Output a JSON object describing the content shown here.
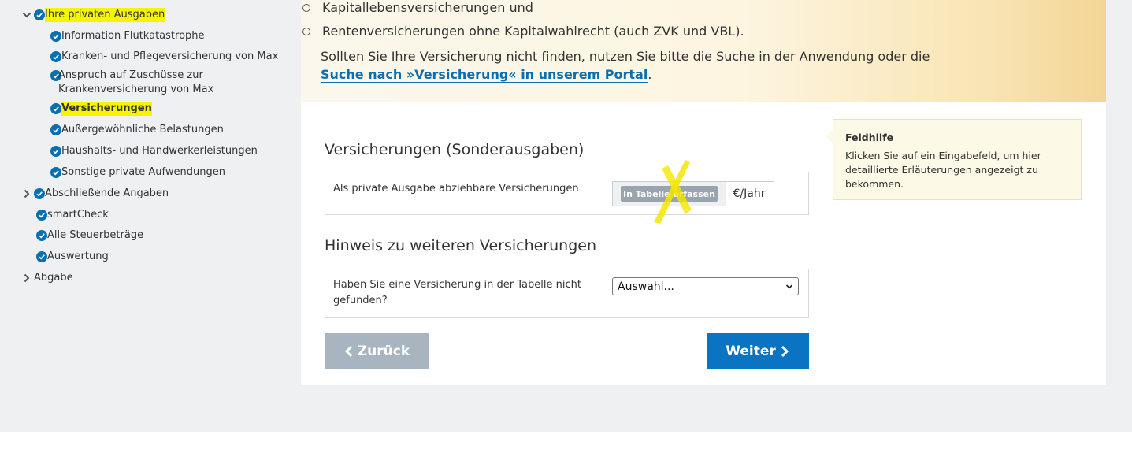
{
  "sidebar": {
    "items": [
      {
        "label": "Ihre privaten Ausgaben"
      },
      {
        "label": "Information Flutkatastrophe"
      },
      {
        "label": "Kranken- und Pflegeversicherung von Max"
      },
      {
        "label": "Anspruch auf Zuschüsse zur Krankenversicherung von Max"
      },
      {
        "label": "Versicherungen"
      },
      {
        "label": "Außergewöhnliche Belastungen"
      },
      {
        "label": "Haushalts- und Handwerkerleistungen"
      },
      {
        "label": "Sonstige private Aufwendungen"
      },
      {
        "label": "Abschließende Angaben"
      },
      {
        "label": "smartCheck"
      },
      {
        "label": "Alle Steuerbeträge"
      },
      {
        "label": "Auswertung"
      },
      {
        "label": "Abgabe"
      }
    ]
  },
  "hero": {
    "bullets": [
      "Kapitallebensversicherungen und",
      "Rentenversicherungen ohne Kapitalwahlrecht (auch ZVK und VBL)."
    ],
    "text_before_link": "Sollten Sie Ihre Versicherung nicht finden, nutzen Sie bitte die Suche in der Anwendung oder die ",
    "link_text": "Suche nach »Versicherung« in unserem Portal",
    "text_after_link": "."
  },
  "section1": {
    "title": "Versicherungen (Sonderausgaben)",
    "field_label": "Als private Ausgabe abziehbare Versicherungen",
    "table_button": "In Tabelle erfassen",
    "unit": "€/Jahr"
  },
  "section2": {
    "title": "Hinweis zu weiteren Versicherungen",
    "field_label": "Haben Sie eine Versicherung in der Tabelle nicht gefunden?",
    "select_value": "Auswahl..."
  },
  "buttons": {
    "back": "Zurück",
    "next": "Weiter"
  },
  "help": {
    "title": "Feldhilfe",
    "text": "Klicken Sie auf ein Eingabefeld, um hier detaillierte Erläuterungen angezeigt zu bekommen."
  },
  "colors": {
    "accent": "#0a74c2",
    "highlight": "#f5f500",
    "back_button": "#a8b4bf"
  }
}
